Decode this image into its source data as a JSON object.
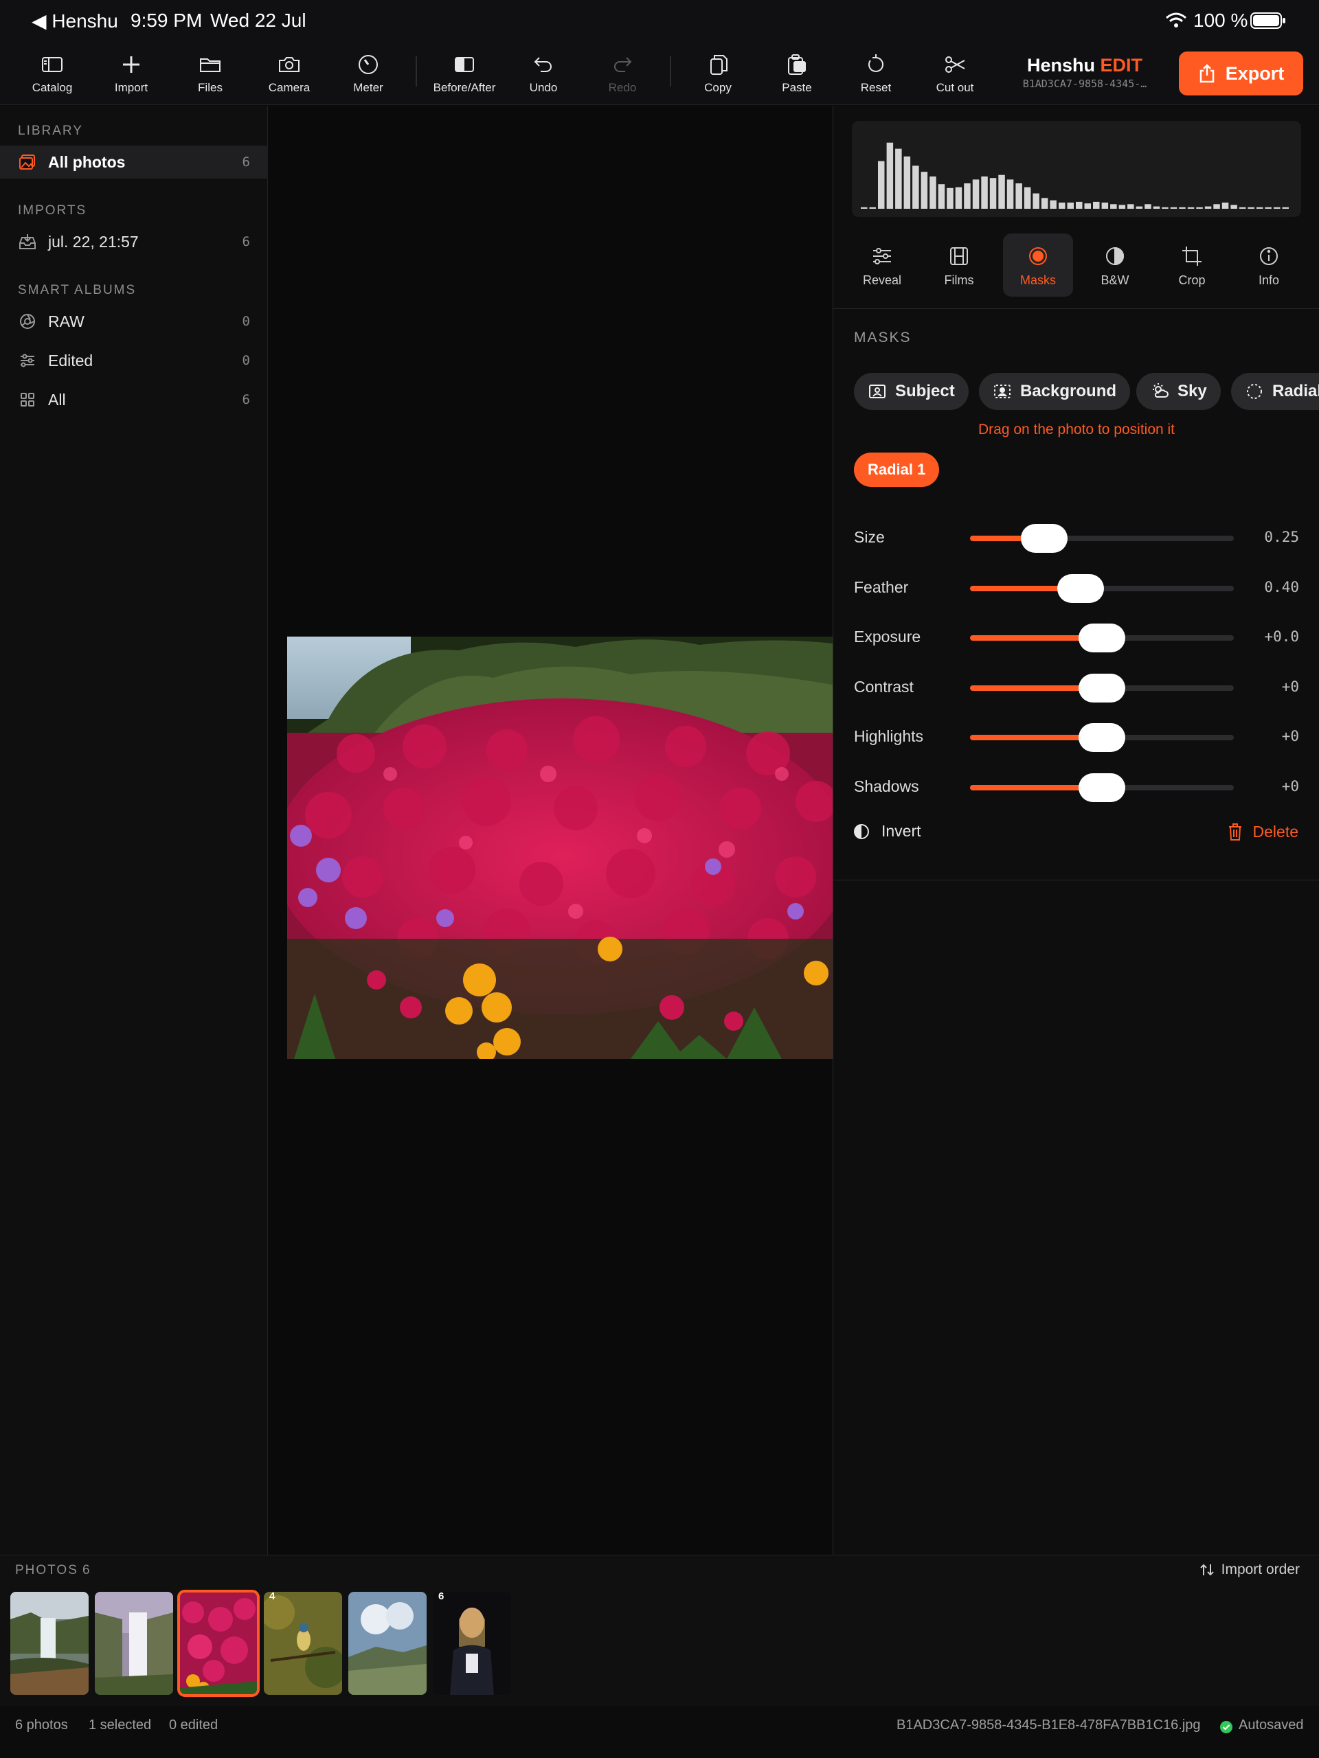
{
  "status": {
    "back_label": "◀ Henshu",
    "time": "9:59 PM",
    "date": "Wed 22 Jul",
    "battery": "100 %"
  },
  "toolbar": {
    "catalog": "Catalog",
    "import": "Import",
    "files": "Files",
    "camera": "Camera",
    "meter": "Meter",
    "before_after": "Before/After",
    "undo": "Undo",
    "redo": "Redo",
    "copy": "Copy",
    "paste": "Paste",
    "reset": "Reset",
    "cut_out": "Cut out"
  },
  "brand": {
    "name": "Henshu",
    "suffix": "EDIT",
    "doc_id": "B1AD3CA7-9858-4345-…"
  },
  "export_label": "Export",
  "sidebar": {
    "library_title": "LIBRARY",
    "all_photos": {
      "label": "All photos",
      "count": "6"
    },
    "imports_title": "IMPORTS",
    "import_item": {
      "label": "jul. 22, 21:57",
      "count": "6"
    },
    "smart_title": "SMART ALBUMS",
    "raw": {
      "label": "RAW",
      "count": "0"
    },
    "edited": {
      "label": "Edited",
      "count": "0"
    },
    "all": {
      "label": "All",
      "count": "6"
    }
  },
  "histogram": [
    0.02,
    0.02,
    0.62,
    0.86,
    0.78,
    0.68,
    0.56,
    0.48,
    0.42,
    0.32,
    0.27,
    0.28,
    0.33,
    0.38,
    0.42,
    0.4,
    0.44,
    0.38,
    0.33,
    0.28,
    0.2,
    0.14,
    0.11,
    0.08,
    0.08,
    0.09,
    0.07,
    0.09,
    0.08,
    0.06,
    0.05,
    0.06,
    0.03,
    0.06,
    0.03,
    0.02,
    0.02,
    0.02,
    0.02,
    0.02,
    0.03,
    0.06,
    0.08,
    0.05,
    0.02,
    0.02,
    0.02,
    0.02,
    0.02,
    0.02
  ],
  "panel_tabs": {
    "reveal": "Reveal",
    "films": "Films",
    "masks": "Masks",
    "bw": "B&W",
    "crop": "Crop",
    "info": "Info"
  },
  "masks": {
    "title": "MASKS",
    "chips": {
      "subject": "Subject",
      "background": "Background",
      "sky": "Sky",
      "radial": "Radial"
    },
    "hint": "Drag on the photo to position it",
    "active_mask": "Radial 1",
    "sliders": [
      {
        "label": "Size",
        "value": "0.25",
        "position": 0.28
      },
      {
        "label": "Feather",
        "value": "0.40",
        "position": 0.42
      },
      {
        "label": "Exposure",
        "value": "+0.0",
        "position": 0.5
      },
      {
        "label": "Contrast",
        "value": "+0",
        "position": 0.5
      },
      {
        "label": "Highlights",
        "value": "+0",
        "position": 0.5
      },
      {
        "label": "Shadows",
        "value": "+0",
        "position": 0.5
      }
    ],
    "invert": "Invert",
    "delete": "Delete"
  },
  "filmstrip": {
    "title": "PHOTOS",
    "count": "6",
    "sort": "Import order",
    "badges": {
      "t4": "4",
      "t6": "6"
    }
  },
  "footer": {
    "photos": "6 photos",
    "selected": "1 selected",
    "edited": "0 edited",
    "filename": "B1AD3CA7-9858-4345-B1E8-478FA7BB1C16.jpg",
    "autosaved": "Autosaved"
  },
  "colors": {
    "accent": "#ff5a22",
    "background": "#0b0b0b",
    "panel": "#0e0e0f",
    "chip": "#2a2a2c",
    "autosave_dot": "#34c759"
  }
}
